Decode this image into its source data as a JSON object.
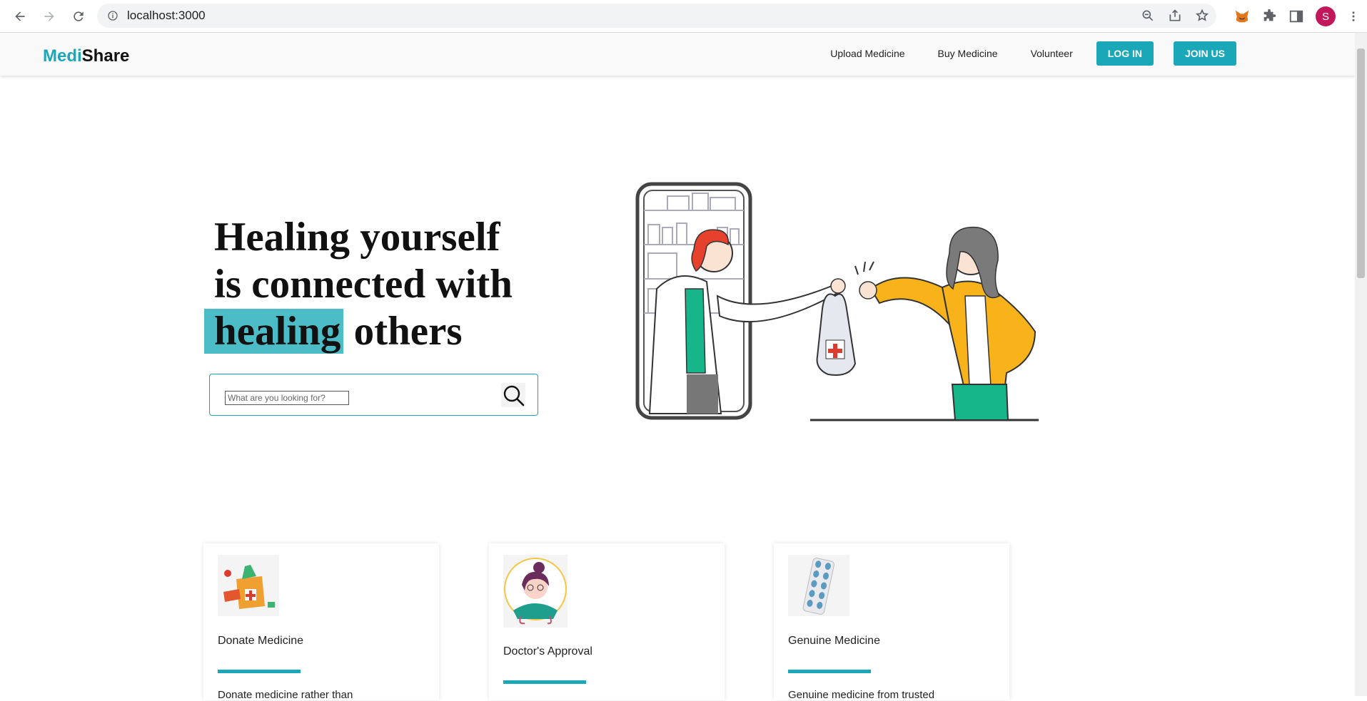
{
  "browser": {
    "url": "localhost:3000",
    "avatar_letter": "S"
  },
  "header": {
    "logo_part1": "Medi",
    "logo_part2": "Share",
    "nav": [
      "Upload Medicine",
      "Buy Medicine",
      "Volunteer"
    ],
    "login_label": "LOG IN",
    "join_label": "JOIN US"
  },
  "hero": {
    "line1": "Healing yourself",
    "line2": "is connected with",
    "highlight_word": "healing",
    "line3_rest": " others",
    "search_placeholder": "What are you looking for?"
  },
  "cards": [
    {
      "title": "Donate Medicine",
      "text": "Donate medicine rather than"
    },
    {
      "title": "Doctor's Approval",
      "text": ""
    },
    {
      "title": "Genuine Medicine",
      "text": "Genuine medicine from trusted"
    }
  ],
  "colors": {
    "accent": "#1aa8b8",
    "highlight": "#4cbcc7"
  }
}
